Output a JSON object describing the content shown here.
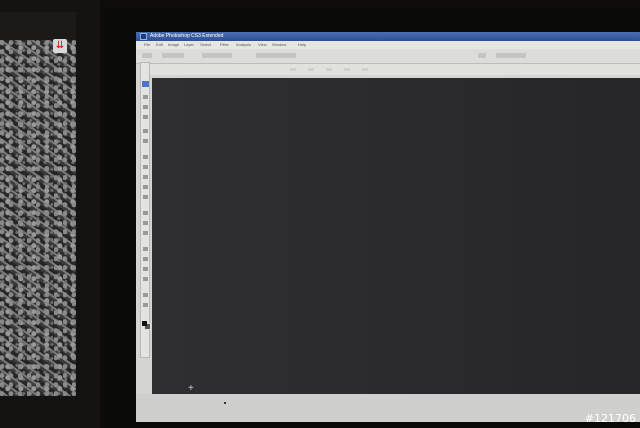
{
  "photoshop": {
    "title": "Adobe Photoshop CS3 Extended",
    "menus": [
      "File",
      "Edit",
      "Image",
      "Layer",
      "Select",
      "Filter",
      "Analysis",
      "View",
      "Window",
      "Help"
    ]
  },
  "watermark": "#121706",
  "colors": {
    "title_bar": "#2d5094",
    "canvas": "#2a2a2c",
    "tray_icon_arrow": "#c0141a"
  },
  "icons": {
    "tray_arrow": "⇊",
    "crosshair": "+"
  }
}
